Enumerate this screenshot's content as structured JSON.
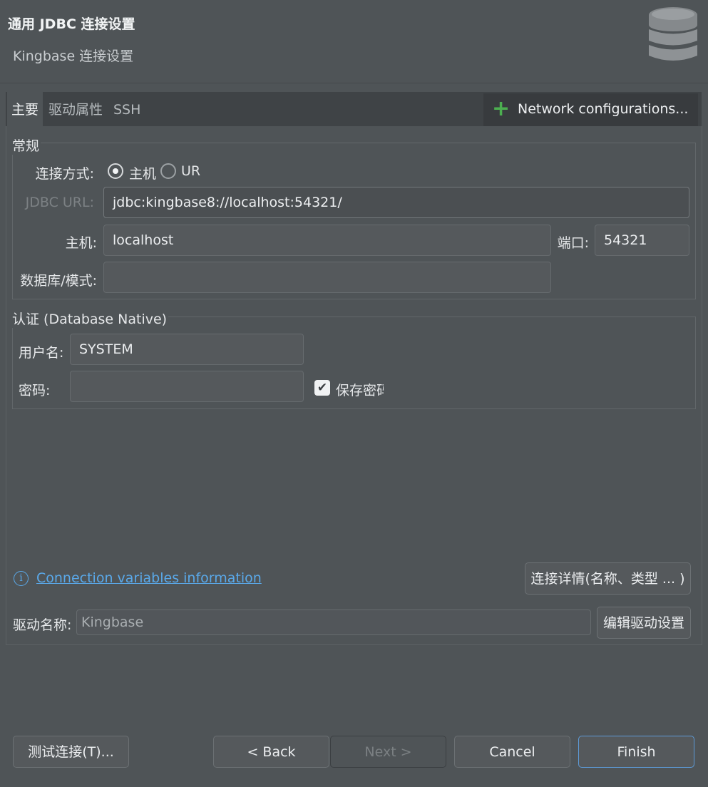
{
  "header": {
    "title": "通用 JDBC 连接设置",
    "subtitle": "Kingbase 连接设置",
    "icon": "database-icon"
  },
  "tabs": [
    {
      "label": "主要",
      "active": true
    },
    {
      "label": "驱动属性",
      "active": false
    },
    {
      "label": "SSH",
      "active": false
    }
  ],
  "network_button": {
    "icon": "plus-icon",
    "label": "Network configurations..."
  },
  "general": {
    "group_label": "常规",
    "connect_by_label": "连接方式:",
    "options": [
      {
        "label": "主机",
        "selected": true
      },
      {
        "label": "UR",
        "selected": false
      }
    ],
    "jdbc_url_label": "JDBC URL:",
    "jdbc_url_value": "jdbc:kingbase8://localhost:54321/",
    "host_label": "主机:",
    "host_value": "localhost",
    "port_label": "端口:",
    "port_value": "54321",
    "database_label": "数据库/模式:",
    "database_value": ""
  },
  "auth": {
    "group_label": "认证 (Database Native)",
    "username_label": "用户名:",
    "username_value": "SYSTEM",
    "password_label": "密码:",
    "password_value": "",
    "save_password_label": "保存密码",
    "save_password_checked": true
  },
  "connection_vars_link": "Connection variables information",
  "connection_details_button": "连接详情(名称、类型 ... )",
  "driver": {
    "label": "驱动名称:",
    "value": "Kingbase",
    "edit_button": "编辑驱动设置"
  },
  "footer": {
    "test_button": "测试连接(T)...",
    "back_button": "< Back",
    "next_button": "Next >",
    "cancel_button": "Cancel",
    "finish_button": "Finish"
  },
  "colors": {
    "background": "#4f5457",
    "tabbar": "#3f4346",
    "link": "#5aa9ea",
    "plus": "#4caf50",
    "primary_border": "#5d9ad6"
  }
}
